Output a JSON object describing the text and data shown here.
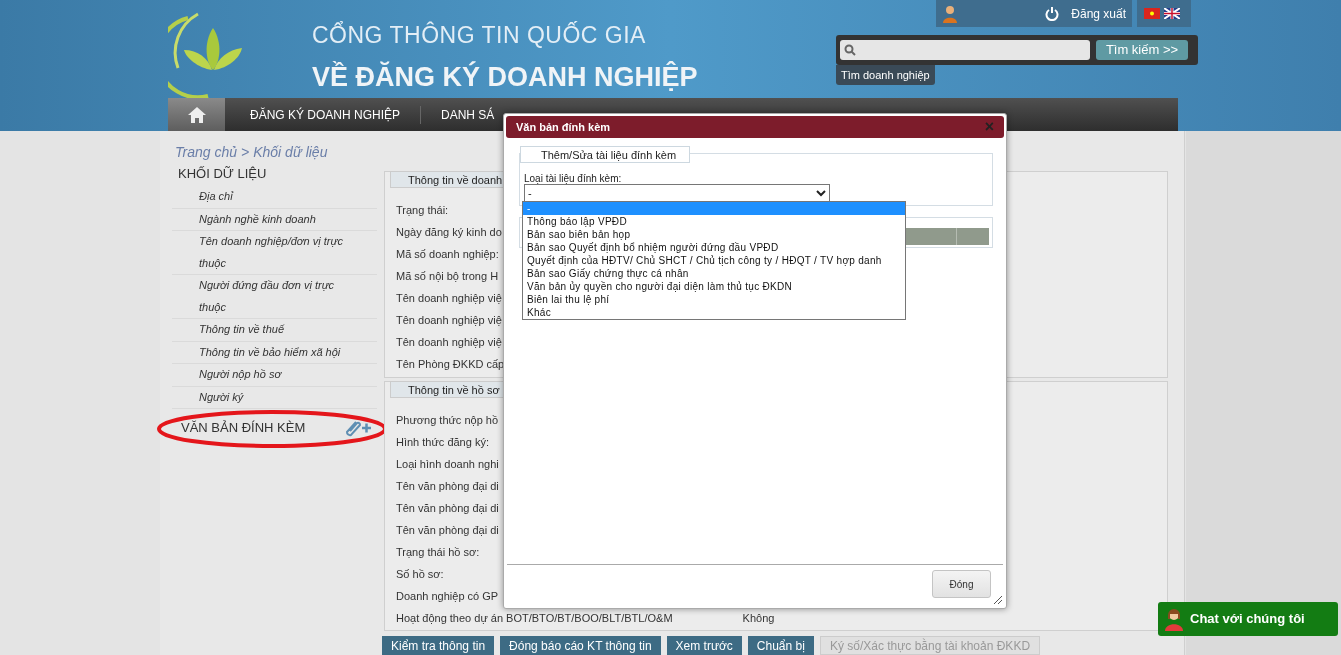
{
  "header": {
    "title_line1": "CỔNG THÔNG TIN QUỐC GIA",
    "title_line2": "VỀ ĐĂNG KÝ DOANH NGHIỆP",
    "logout": "Đăng xuất",
    "search": {
      "button": "Tìm kiếm >>",
      "tab": "Tìm doanh nghiệp"
    }
  },
  "nav": {
    "items": [
      "ĐĂNG KÝ DOANH NGHIỆP",
      "DANH SÁ"
    ]
  },
  "breadcrumb": {
    "home": "Trang chủ",
    "current": "Khối dữ liệu",
    "separator": ">"
  },
  "sidebar": {
    "heading": "KHỐI DỮ LIỆU",
    "items": [
      "Địa chỉ",
      "Ngành nghề kinh doanh",
      "Tên doanh nghiệp/đơn vị trực thuộc",
      "Người đứng đầu đơn vị trực thuộc",
      "Thông tin về thuế",
      "Thông tin về bảo hiểm xã hội",
      "Người nộp hồ sơ",
      "Người ký"
    ],
    "attachments_heading": "VĂN BẢN ĐÍNH KÈM"
  },
  "sections": [
    {
      "legend": "Thông tin về doanh",
      "rows": [
        {
          "label": "Trạng thái:"
        },
        {
          "label": "Ngày đăng ký kinh do"
        },
        {
          "label": "Mã số doanh nghiệp:"
        },
        {
          "label": "Mã số nội bộ trong H"
        },
        {
          "label": "Tên doanh nghiệp việ"
        },
        {
          "label": "Tên doanh nghiệp việ"
        },
        {
          "label": "Tên doanh nghiệp việ"
        },
        {
          "label": "Tên Phòng ĐKKD cấp"
        }
      ]
    },
    {
      "legend": "Thông tin về hồ sơ",
      "rows": [
        {
          "label": "Phương thức nộp hồ"
        },
        {
          "label": "Hình thức đăng ký:"
        },
        {
          "label": "Loại hình doanh nghi"
        },
        {
          "label": "Tên văn phòng đại di"
        },
        {
          "label": "Tên văn phòng đại di"
        },
        {
          "label": "Tên văn phòng đại di"
        },
        {
          "label": "Trạng thái hồ sơ:"
        },
        {
          "label": "Số hồ sơ:"
        },
        {
          "label": "Doanh nghiệp có GP"
        },
        {
          "label": "Hoạt động theo dự án BOT/BTO/BT/BOO/BLT/BTL/O&M",
          "value": "Không"
        }
      ]
    }
  ],
  "actions": [
    {
      "label": "Kiểm tra thông tin",
      "disabled": false
    },
    {
      "label": "Đóng báo cáo KT thông tin",
      "disabled": false
    },
    {
      "label": "Xem trước",
      "disabled": false
    },
    {
      "label": "Chuẩn bị",
      "disabled": false
    },
    {
      "label": "Ký số/Xác thực bằng tài khoản ĐKKD",
      "disabled": true
    }
  ],
  "chat": "Chat với chúng tôi",
  "dialog": {
    "title": "Văn bản đính kèm",
    "close": "×",
    "legend": "Thêm/Sửa tài liệu đính kèm",
    "field_label": "Loại tài liệu đính kèm:",
    "select_value": "-",
    "options": [
      {
        "label": "-",
        "selected": true
      },
      {
        "label": "Thông báo lập VPĐD",
        "selected": false
      },
      {
        "label": "Bản sao biên bản họp",
        "selected": false
      },
      {
        "label": "Bản sao Quyết định bổ nhiệm người đứng đầu VPĐD",
        "selected": false
      },
      {
        "label": "Quyết định của HĐTV/ Chủ SHCT / Chủ tịch công ty / HĐQT / TV hợp danh",
        "selected": false
      },
      {
        "label": "Bản sao Giấy chứng thực cá nhân",
        "selected": false
      },
      {
        "label": "Văn bản ủy quyền cho người đại diện làm thủ tục ĐKDN",
        "selected": false
      },
      {
        "label": "Biên lai thu lệ phí",
        "selected": false
      },
      {
        "label": "Khác",
        "selected": false
      }
    ],
    "footer_button": "Đóng"
  }
}
